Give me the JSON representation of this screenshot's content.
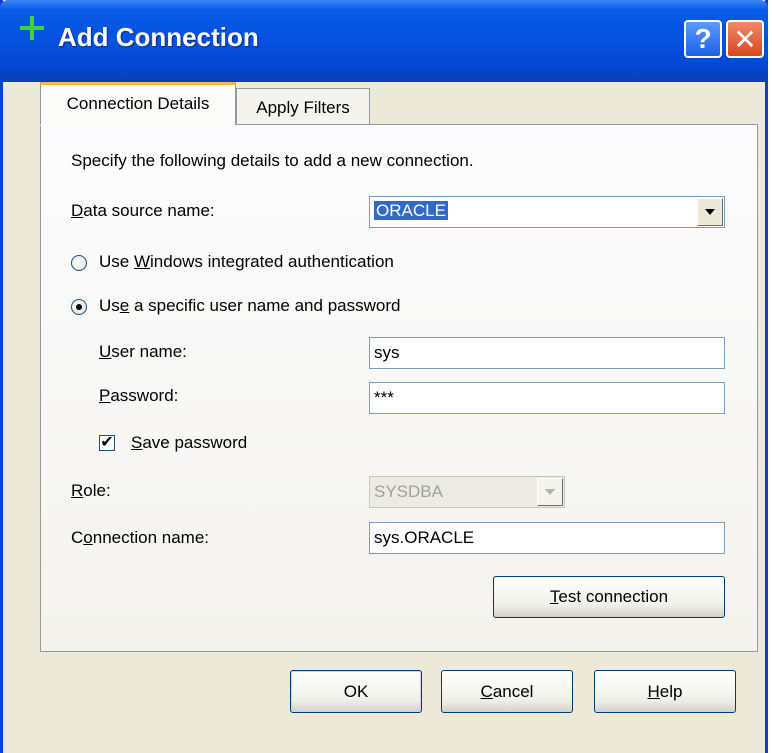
{
  "window": {
    "title": "Add Connection",
    "help_glyph": "?",
    "close_glyph": "✕",
    "title_icon": "plus-icon",
    "colors": {
      "titlebar": "#0552e0",
      "dialog_bg": "#ece9d8",
      "selection": "#316ac5",
      "plus": "#3fd13f"
    }
  },
  "tabs": [
    {
      "label": "Connection Details",
      "active": true
    },
    {
      "label": "Apply Filters",
      "active": false
    }
  ],
  "form": {
    "intro": "Specify the following details to add a new connection.",
    "data_source": {
      "label_u": "D",
      "label_rest": "ata source name:",
      "value": "ORACLE"
    },
    "auth_windows": {
      "pre": "Use ",
      "u": "W",
      "post": "indows integrated authentication",
      "checked": false
    },
    "auth_specific": {
      "pre": "Us",
      "u": "e",
      "post": " a specific user name and password",
      "checked": true
    },
    "user_name": {
      "label_u": "U",
      "label_rest": "ser name:",
      "value": "sys"
    },
    "password": {
      "label_u": "P",
      "label_rest": "assword:",
      "value": "***"
    },
    "save_password": {
      "label_u": "S",
      "label_rest": "ave password",
      "checked": true,
      "mark": "✔"
    },
    "role": {
      "label_u": "R",
      "label_rest": "ole:",
      "value": "SYSDBA"
    },
    "connection_name": {
      "label_pre": "C",
      "label_u": "o",
      "label_rest": "nnection name:",
      "value": "sys.ORACLE"
    },
    "test_button": {
      "label_u": "T",
      "label_rest": "est connection"
    }
  },
  "buttons": {
    "ok": "OK",
    "cancel": {
      "u": "C",
      "rest": "ancel"
    },
    "help": {
      "u": "H",
      "rest": "elp"
    }
  }
}
